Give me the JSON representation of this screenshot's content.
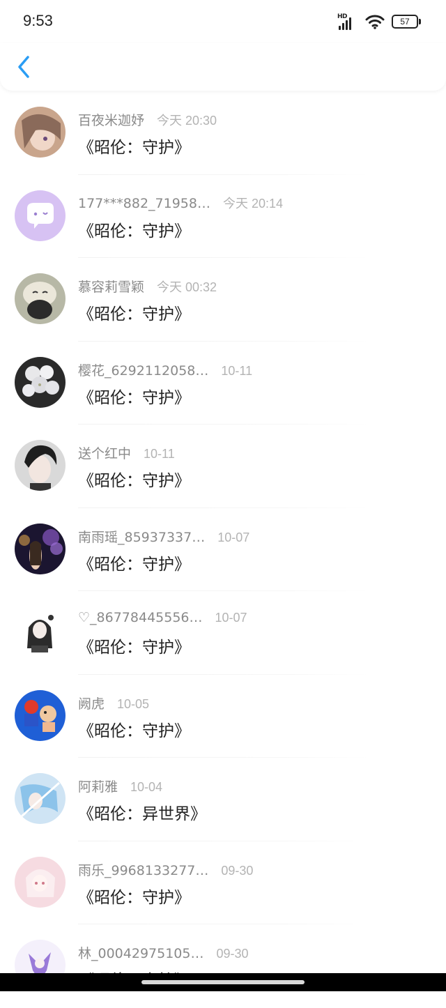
{
  "status_bar": {
    "time": "9:53",
    "signal_label": "HD",
    "battery": "57"
  },
  "header": {
    "back_icon": "chevron-left-icon",
    "accent": "#2a9df4"
  },
  "list": [
    {
      "name": "百夜米迦妤",
      "date": "今天 20:30",
      "message": "《昭伦：守护》",
      "avatar": "anime-girl-avatar"
    },
    {
      "name": "177***882_71958…",
      "date": "今天 20:14",
      "message": "《昭伦：守护》",
      "avatar": "default-chat-avatar"
    },
    {
      "name": "慕容莉雪颖",
      "date": "今天 00:32",
      "message": "《昭伦：守护》",
      "avatar": "plush-toy-avatar"
    },
    {
      "name": "樱花_6292112058…",
      "date": "10-11",
      "message": "《昭伦：守护》",
      "avatar": "flowers-avatar"
    },
    {
      "name": "送个红中",
      "date": "10-11",
      "message": "《昭伦：守护》",
      "avatar": "anime-boy-avatar"
    },
    {
      "name": "南雨瑶_85937337…",
      "date": "10-07",
      "message": "《昭伦：守护》",
      "avatar": "night-flowers-avatar"
    },
    {
      "name": "♡_86778445556…",
      "date": "10-07",
      "message": "《昭伦：守护》",
      "avatar": "anime-chibi-avatar"
    },
    {
      "name": "阙虎",
      "date": "10-05",
      "message": "《昭伦：守护》",
      "avatar": "cartoon-avatar"
    },
    {
      "name": "阿莉雅",
      "date": "10-04",
      "message": "《昭伦：异世界》",
      "avatar": "anime-blue-avatar"
    },
    {
      "name": "雨乐_9968133277…",
      "date": "09-30",
      "message": "《昭伦：守护》",
      "avatar": "anime-pink-avatar"
    },
    {
      "name": "林_00042975105…",
      "date": "09-30",
      "message": "《昭伦：守护》",
      "avatar": "anime-purple-avatar"
    }
  ]
}
